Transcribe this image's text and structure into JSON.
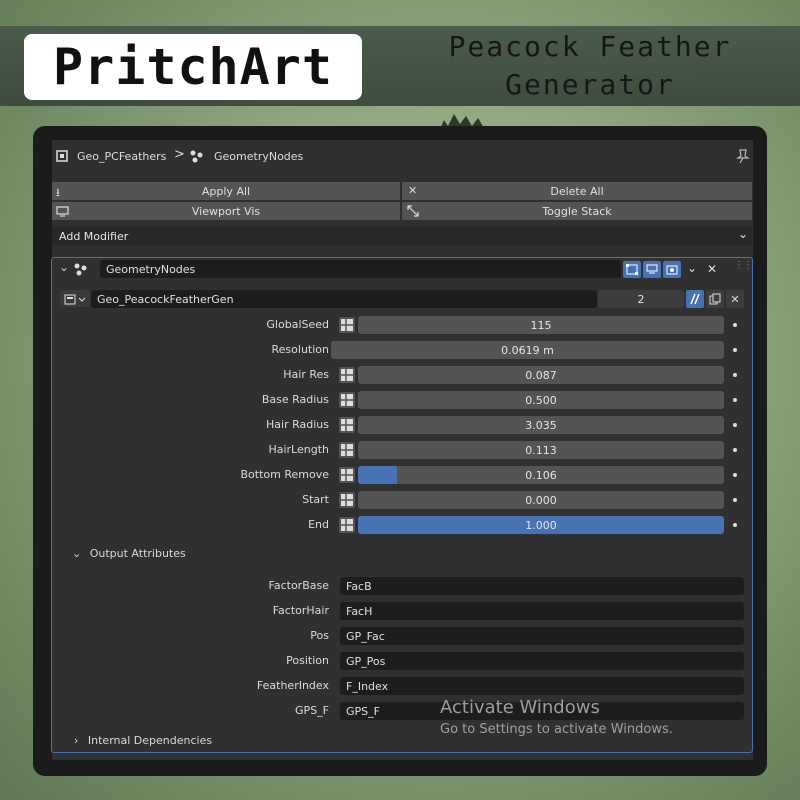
{
  "banner": {
    "brand": "PritchArt",
    "title_line1": "Peacock Feather",
    "title_line2": "Generator"
  },
  "header": {
    "object_name": "Geo_PCFeathers",
    "separator": ">",
    "modifier_name": "GeometryNodes"
  },
  "toolbar": {
    "apply_all": "Apply All",
    "delete_all": "Delete All",
    "viewport_vis": "Viewport Vis",
    "toggle_stack": "Toggle Stack",
    "add_modifier": "Add Modifier"
  },
  "modifier": {
    "name": "GeometryNodes",
    "node_group": "Geo_PeacockFeatherGen",
    "users": "2",
    "inputs": [
      {
        "label": "GlobalSeed",
        "value": "115",
        "fill": 0
      },
      {
        "label": "Resolution",
        "value": "0.0619 m",
        "fill": 0
      },
      {
        "label": "Hair Res",
        "value": "0.087",
        "fill": 0
      },
      {
        "label": "Base Radius",
        "value": "0.500",
        "fill": 0
      },
      {
        "label": "Hair Radius",
        "value": "3.035",
        "fill": 0
      },
      {
        "label": "HairLength",
        "value": "0.113",
        "fill": 0
      },
      {
        "label": "Bottom Remove",
        "value": "0.106",
        "fill": 0.106
      },
      {
        "label": "Start",
        "value": "0.000",
        "fill": 0
      },
      {
        "label": "End",
        "value": "1.000",
        "fill": 1
      }
    ],
    "output_section": "Output Attributes",
    "outputs": [
      {
        "label": "FactorBase",
        "value": "FacB"
      },
      {
        "label": "FactorHair",
        "value": "FacH"
      },
      {
        "label": "Pos",
        "value": "GP_Fac"
      },
      {
        "label": "Position",
        "value": "GP_Pos"
      },
      {
        "label": "FeatherIndex",
        "value": "F_Index"
      },
      {
        "label": "GPS_F",
        "value": "GPS_F"
      }
    ],
    "internal_section": "Internal Dependencies"
  },
  "watermark": {
    "line1": "Activate Windows",
    "line2": "Go to Settings to activate Windows."
  },
  "colors": {
    "accent": "#4772b3",
    "panel": "#303030",
    "field": "#545454",
    "field_dark": "#1d1d1d"
  }
}
